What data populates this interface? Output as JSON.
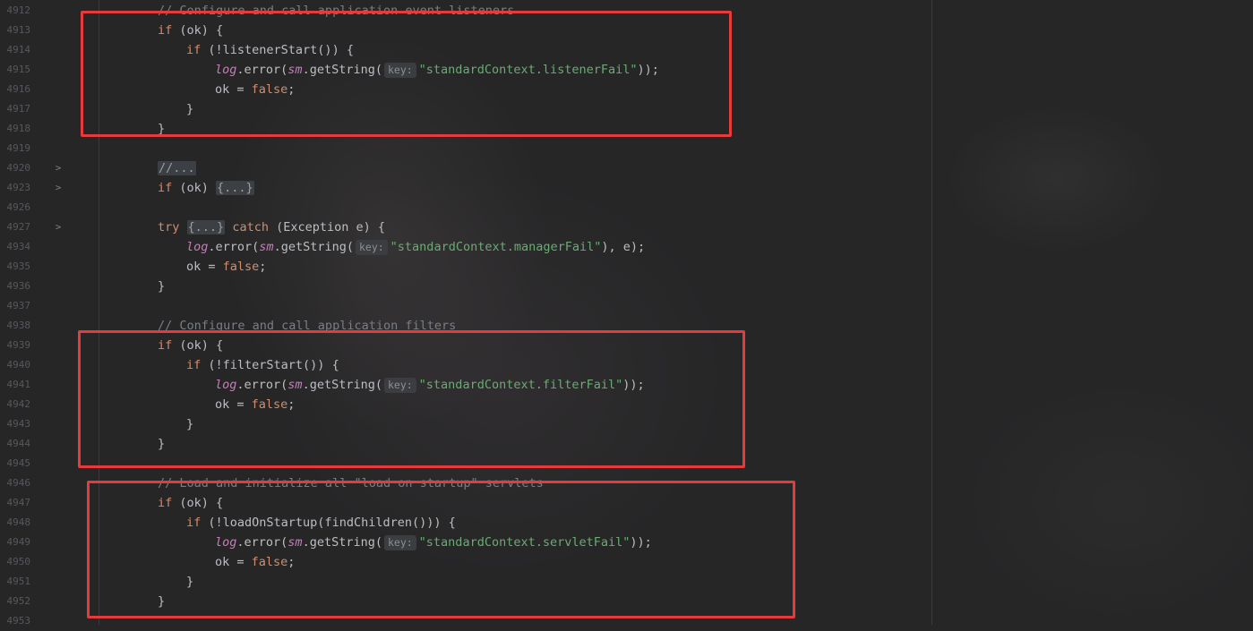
{
  "editor": {
    "line_numbers": [
      "4912",
      "4913",
      "4914",
      "4915",
      "4916",
      "4917",
      "4918",
      "4919",
      "4920",
      "4923",
      "4926",
      "4927",
      "4934",
      "4935",
      "4936",
      "4937",
      "4938",
      "4939",
      "4940",
      "4941",
      "4942",
      "4943",
      "4944",
      "4945",
      "4946",
      "4947",
      "4948",
      "4949",
      "4950",
      "4951",
      "4952",
      "4953"
    ],
    "fold_markers": [
      ">",
      ">",
      ">"
    ],
    "lines": [
      {
        "comment": "// Configure and call application event listeners"
      },
      {
        "kw1": "if",
        "t1": " (ok) {"
      },
      {
        "kw1": "if",
        "t1": " (!listenerStart()) {"
      },
      {
        "field1": "log",
        "t1": ".error(",
        "field2": "sm",
        "t2": ".getString(",
        "hint": "key:",
        "str": "\"standardContext.listenerFail\"",
        "t3": "));"
      },
      {
        "t1": "ok = ",
        "kw1": "false",
        "t2": ";"
      },
      {
        "t1": "}"
      },
      {
        "t1": "}"
      },
      {
        "t1": ""
      },
      {
        "folded": "//..."
      },
      {
        "kw1": "if",
        "t1": " (ok) ",
        "folded": "{...}"
      },
      {
        "t1": ""
      },
      {
        "kw1": "try",
        "folded": "{...}",
        "kw2": "catch",
        "t1": " (Exception e) {"
      },
      {
        "field1": "log",
        "t1": ".error(",
        "field2": "sm",
        "t2": ".getString(",
        "hint": "key:",
        "str": "\"standardContext.managerFail\"",
        "t3": "), e);"
      },
      {
        "t1": "ok = ",
        "kw1": "false",
        "t2": ";"
      },
      {
        "t1": "}"
      },
      {
        "t1": ""
      },
      {
        "comment": "// Configure and call application filters"
      },
      {
        "kw1": "if",
        "t1": " (ok) {"
      },
      {
        "kw1": "if",
        "t1": " (!filterStart()) {"
      },
      {
        "field1": "log",
        "t1": ".error(",
        "field2": "sm",
        "t2": ".getString(",
        "hint": "key:",
        "str": "\"standardContext.filterFail\"",
        "t3": "));"
      },
      {
        "t1": "ok = ",
        "kw1": "false",
        "t2": ";"
      },
      {
        "t1": "}"
      },
      {
        "t1": "}"
      },
      {
        "t1": ""
      },
      {
        "comment": "// Load and initialize all \"load on startup\" servlets"
      },
      {
        "kw1": "if",
        "t1": " (ok) {"
      },
      {
        "kw1": "if",
        "t1": " (!loadOnStartup(findChildren())) {"
      },
      {
        "field1": "log",
        "t1": ".error(",
        "field2": "sm",
        "t2": ".getString(",
        "hint": "key:",
        "str": "\"standardContext.servletFail\"",
        "t3": "));"
      },
      {
        "t1": "ok = ",
        "kw1": "false",
        "t2": ";"
      },
      {
        "t1": "}"
      },
      {
        "t1": "}"
      },
      {
        "t1": ""
      }
    ]
  },
  "highlight_color": "#e63a3d"
}
